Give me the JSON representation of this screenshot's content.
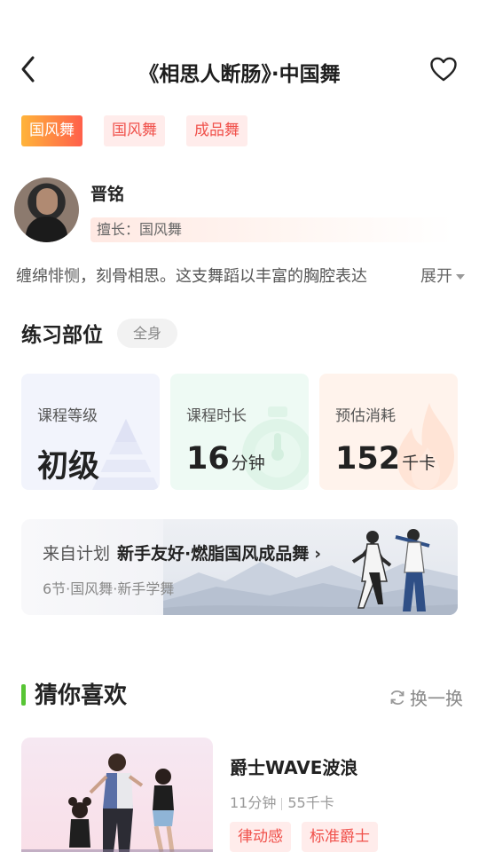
{
  "header": {
    "title": "《相思人断肠》·中国舞",
    "back_icon": "chevron-left-icon",
    "favorite_icon": "heart-outline-icon"
  },
  "tags": [
    "国风舞",
    "国风舞",
    "成品舞"
  ],
  "teacher": {
    "name": "晋铭",
    "specialty": "擅长：国风舞"
  },
  "description": {
    "text": "缠绵悱恻，刻骨相思。这支舞蹈以丰富的胸腔表达",
    "expand_label": "展开"
  },
  "practice_parts": {
    "title": "练习部位",
    "badge": "全身"
  },
  "stats": {
    "level": {
      "label": "课程等级",
      "value": "初级",
      "unit": ""
    },
    "duration": {
      "label": "课程时长",
      "value": "16",
      "unit": "分钟"
    },
    "calorie": {
      "label": "预估消耗",
      "value": "152",
      "unit": "千卡"
    }
  },
  "plan": {
    "prefix": "来自计划",
    "name": "新手友好·燃脂国风成品舞",
    "subtitle": "6节·国风舞·新手学舞"
  },
  "guess": {
    "title": "猜你喜欢",
    "refresh_label": "换一换",
    "accent_color": "#57c534"
  },
  "recommendation": {
    "title": "爵士WAVE波浪",
    "duration": "11分钟",
    "calories": "55千卡",
    "tags": [
      "律动感",
      "标准爵士"
    ]
  },
  "colors": {
    "tag_primary_start": "#ffb43a",
    "tag_primary_end": "#ff5f4b",
    "tag_text": "#f0514b"
  }
}
